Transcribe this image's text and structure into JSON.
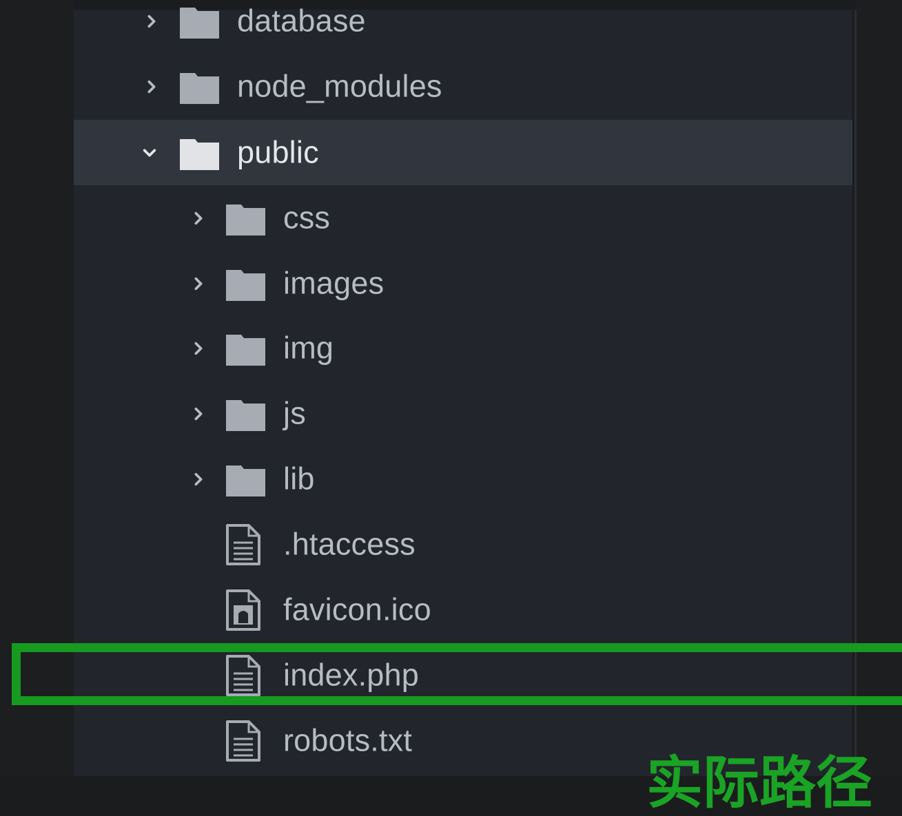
{
  "file_tree": {
    "items": [
      {
        "name": "database",
        "type": "folder",
        "expanded": false
      },
      {
        "name": "node_modules",
        "type": "folder",
        "expanded": false
      },
      {
        "name": "public",
        "type": "folder",
        "expanded": true,
        "selected": true
      },
      {
        "name": "css",
        "type": "folder",
        "expanded": false
      },
      {
        "name": "images",
        "type": "folder",
        "expanded": false
      },
      {
        "name": "img",
        "type": "folder",
        "expanded": false
      },
      {
        "name": "js",
        "type": "folder",
        "expanded": false
      },
      {
        "name": "lib",
        "type": "folder",
        "expanded": false
      },
      {
        "name": ".htaccess",
        "type": "file",
        "icon": "text-file-icon"
      },
      {
        "name": "favicon.ico",
        "type": "file",
        "icon": "image-file-icon"
      },
      {
        "name": "index.php",
        "type": "file",
        "icon": "text-file-icon",
        "highlighted": true
      },
      {
        "name": "robots.txt",
        "type": "file",
        "icon": "text-file-icon"
      }
    ]
  },
  "annotation": {
    "color": "#169a20",
    "text": "实际路径"
  },
  "colors": {
    "panel_bg": "#22252b",
    "selected_bg": "#31353d",
    "label": "#b7bcc4",
    "icon": "#a7abb3"
  }
}
